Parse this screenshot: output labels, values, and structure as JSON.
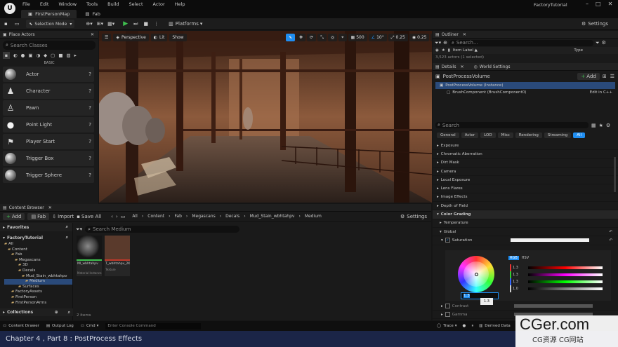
{
  "menubar": {
    "items": [
      "File",
      "Edit",
      "Window",
      "Tools",
      "Build",
      "Select",
      "Actor",
      "Help"
    ],
    "project": "FactoryTutorial"
  },
  "tabs": [
    "FirstPersonMap",
    "Fab"
  ],
  "toolbar": {
    "mode": "Selection Mode",
    "platforms": "Platforms",
    "settings": "Settings"
  },
  "place_actors": {
    "title": "Place Actors",
    "search_placeholder": "Search Classes",
    "section": "BASIC",
    "items": [
      "Actor",
      "Character",
      "Pawn",
      "Point Light",
      "Player Start",
      "Trigger Box",
      "Trigger Sphere"
    ]
  },
  "viewport": {
    "perspective": "Perspective",
    "lit": "Lit",
    "show": "Show",
    "grid": "500",
    "angle": "10°",
    "scale1": "0.25",
    "scale2": "0.25"
  },
  "content_browser": {
    "title": "Content Browser",
    "add": "Add",
    "fab": "Fab",
    "import": "Import",
    "save_all": "Save All",
    "settings": "Settings",
    "path": [
      "All",
      "Content",
      "Fab",
      "Megascans",
      "Decals",
      "Mud_Stain_wbhtahpv",
      "Medium"
    ],
    "favorites": "Favorites",
    "project": "FactoryTutorial",
    "search_placeholder": "Search Medium",
    "tree": [
      "All",
      "Content",
      "Fab",
      "Megascans",
      "3D",
      "Decals",
      "Mud_Stain_wbhtahpv",
      "Medium",
      "Surfaces",
      "FactoryAssets",
      "FirstPerson",
      "FirstPersonArms"
    ],
    "collections": "Collections",
    "items_count": "2 items",
    "assets": [
      {
        "name": "MI_wbhtahpv",
        "type": "Material Instance"
      },
      {
        "name": "T_wbhtahpv_2K_ORD",
        "type": "Texture"
      }
    ]
  },
  "outliner": {
    "title": "Outliner",
    "search_placeholder": "Search...",
    "col_label": "Item Label ▲",
    "col_type": "Type",
    "count": "3,523 actors (1 selected)"
  },
  "details": {
    "tab": "Details",
    "tab2": "World Settings",
    "object": "PostProcessVolume",
    "add": "Add",
    "instance": "PostProcessVolume (Instance)",
    "component": "BrushComponent (BrushComponent0)",
    "edit_cpp": "Edit in C++",
    "search_placeholder": "Search",
    "filters": [
      "General",
      "Actor",
      "LOD",
      "Misc",
      "Rendering",
      "Streaming",
      "All"
    ],
    "categories": [
      "Exposure",
      "Chromatic Aberration",
      "Dirt Mask",
      "Camera",
      "Local Exposure",
      "Lens Flares",
      "Image Effects",
      "Depth of Field",
      "Color Grading",
      "Temperature",
      "Global",
      "Saturation"
    ],
    "rgb": "RGB",
    "hsv": "HSV",
    "values": [
      "1.3",
      "1.3",
      "1.3",
      "1.0"
    ],
    "input_val": "1.3",
    "tooltip": "1.3",
    "sub": [
      "Contrast",
      "Gamma"
    ]
  },
  "statusbar": {
    "drawer": "Content Drawer",
    "output": "Output Log",
    "cmd": "Cmd",
    "console_placeholder": "Enter Console Command",
    "trace": "Trace",
    "derived": "Derived Data"
  },
  "chapter": "Chapter 4 , Part 8 : PostProcess Effects",
  "watermark": {
    "title": "CGer.com",
    "sub": "CG资源 CG网站"
  },
  "colors": {
    "accent": "#1f8ef2",
    "play": "#3fbf4f",
    "selection": "#2a4a7a"
  }
}
